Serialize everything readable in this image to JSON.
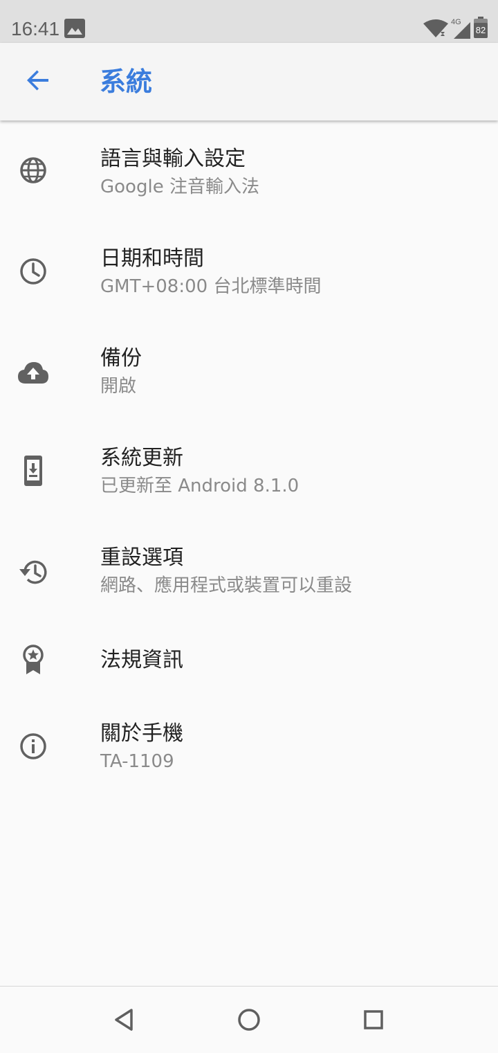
{
  "status_bar": {
    "time": "16:41",
    "network": "4G",
    "battery": "82",
    "icons": [
      "image-icon",
      "wifi-icon",
      "cell-signal-icon",
      "battery-icon"
    ]
  },
  "app_bar": {
    "title": "系統",
    "back_icon": "arrow-back-icon",
    "accent_color": "#3b7ddd"
  },
  "settings": {
    "items": [
      {
        "title": "語言與輸入設定",
        "subtitle": "Google 注音輸入法",
        "icon": "globe-icon"
      },
      {
        "title": "日期和時間",
        "subtitle": "GMT+08:00 台北標準時間",
        "icon": "clock-icon"
      },
      {
        "title": "備份",
        "subtitle": "開啟",
        "icon": "cloud-upload-icon"
      },
      {
        "title": "系統更新",
        "subtitle": "已更新至 Android 8.1.0",
        "icon": "system-update-icon"
      },
      {
        "title": "重設選項",
        "subtitle": "網路、應用程式或裝置可以重設",
        "icon": "restore-icon"
      },
      {
        "title": "法規資訊",
        "subtitle": "",
        "icon": "badge-star-icon"
      },
      {
        "title": "關於手機",
        "subtitle": "TA-1109",
        "icon": "info-icon"
      }
    ]
  },
  "nav_bar": {
    "icons": [
      "back-triangle-icon",
      "home-circle-icon",
      "recents-square-icon"
    ]
  }
}
